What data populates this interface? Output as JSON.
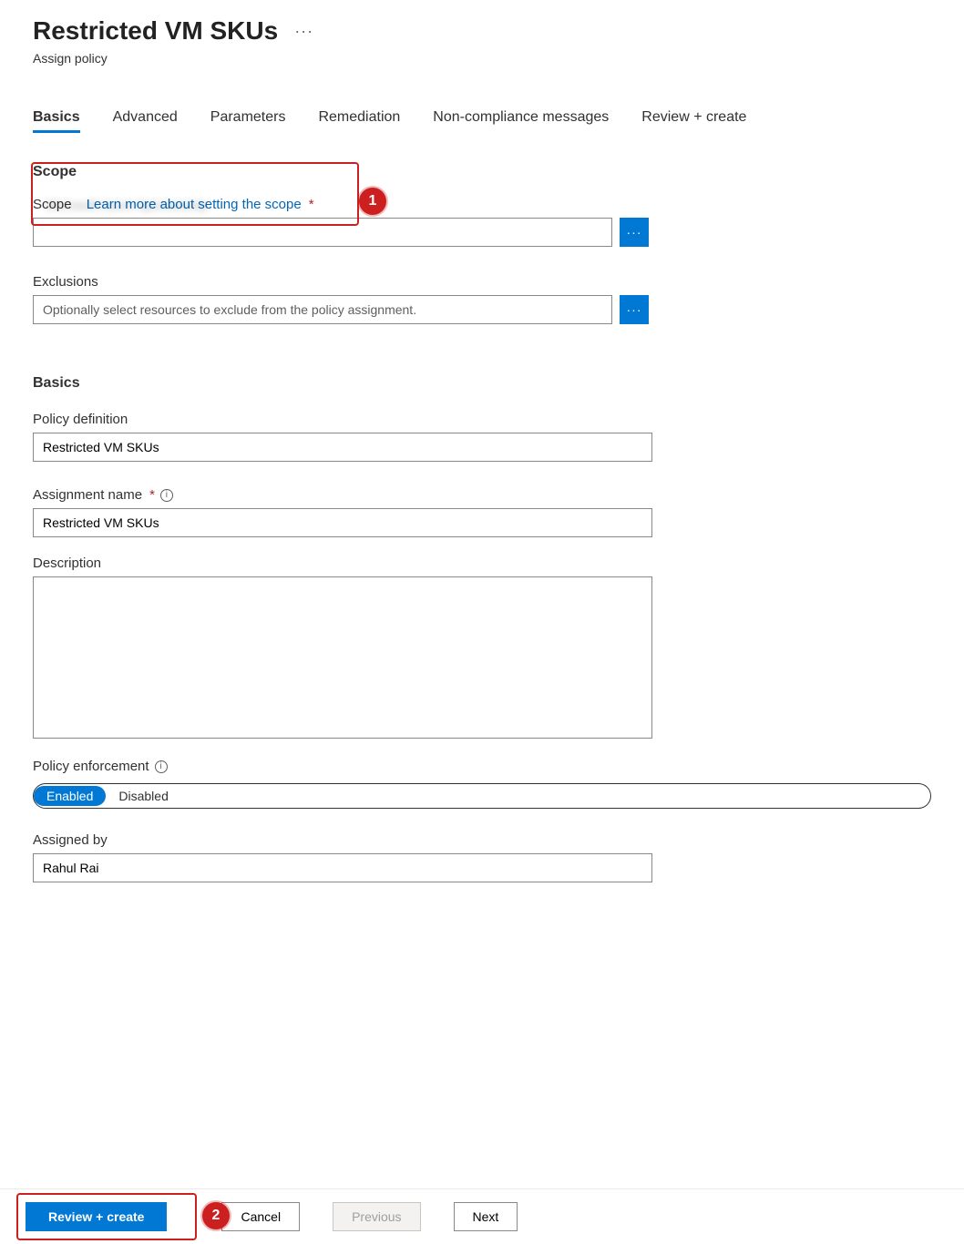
{
  "header": {
    "title": "Restricted VM SKUs",
    "subtitle": "Assign policy"
  },
  "tabs": [
    {
      "label": "Basics",
      "active": true
    },
    {
      "label": "Advanced",
      "active": false
    },
    {
      "label": "Parameters",
      "active": false
    },
    {
      "label": "Remediation",
      "active": false
    },
    {
      "label": "Non-compliance messages",
      "active": false
    },
    {
      "label": "Review + create",
      "active": false
    }
  ],
  "scope": {
    "heading": "Scope",
    "label": "Scope",
    "learn_more": "Learn more about setting the scope",
    "value": "",
    "exclusions_label": "Exclusions",
    "exclusions_placeholder": "Optionally select resources to exclude from the policy assignment."
  },
  "basics": {
    "heading": "Basics",
    "policy_definition_label": "Policy definition",
    "policy_definition_value": "Restricted VM SKUs",
    "assignment_name_label": "Assignment name",
    "assignment_name_value": "Restricted VM SKUs",
    "description_label": "Description",
    "description_value": "",
    "policy_enforcement_label": "Policy enforcement",
    "enforcement_enabled": "Enabled",
    "enforcement_disabled": "Disabled",
    "assigned_by_label": "Assigned by",
    "assigned_by_value": "Rahul Rai"
  },
  "footer": {
    "review_create": "Review + create",
    "cancel": "Cancel",
    "previous": "Previous",
    "next": "Next"
  },
  "callouts": {
    "one": "1",
    "two": "2"
  }
}
